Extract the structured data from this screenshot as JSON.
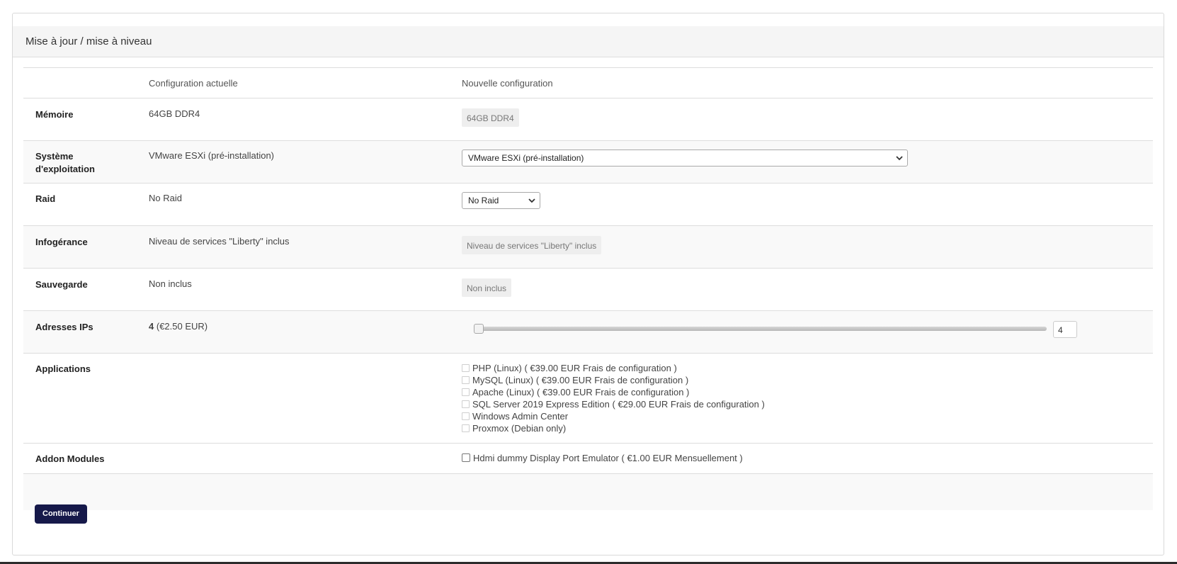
{
  "panel": {
    "title": "Mise à jour / mise à niveau"
  },
  "table": {
    "header": {
      "current": "Configuration actuelle",
      "new": "Nouvelle configuration"
    },
    "rows": {
      "memory": {
        "label": "Mémoire",
        "current": "64GB DDR4",
        "new": "64GB DDR4"
      },
      "os": {
        "label": "Système d'exploitation",
        "current": "VMware ESXi (pré-installation)",
        "new_selected": "VMware ESXi (pré-installation)"
      },
      "raid": {
        "label": "Raid",
        "current": "No Raid",
        "new_selected": "No Raid"
      },
      "managed": {
        "label": "Infogérance",
        "current": "Niveau de services \"Liberty\" inclus",
        "new": "Niveau de services \"Liberty\" inclus"
      },
      "backup": {
        "label": "Sauvegarde",
        "current": "Non inclus",
        "new": "Non inclus"
      },
      "ips": {
        "label": "Adresses IPs",
        "current_qty": "4",
        "current_price": "(€2.50 EUR)",
        "slider_value": "4",
        "slider_fraction": 0.0
      },
      "applications": {
        "label": "Applications",
        "options": [
          "PHP (Linux) ( €39.00 EUR Frais de configuration )",
          "MySQL (Linux) ( €39.00 EUR Frais de configuration )",
          "Apache (Linux) ( €39.00 EUR Frais de configuration )",
          "SQL Server 2019 Express Edition ( €29.00 EUR Frais de configuration )",
          "Windows Admin Center",
          "Proxmox (Debian only)"
        ]
      },
      "addons": {
        "label": "Addon Modules",
        "options": [
          "Hdmi dummy Display Port Emulator ( €1.00 EUR Mensuellement )"
        ]
      }
    }
  },
  "actions": {
    "continue_label": "Continuer"
  },
  "colors": {
    "button_bg": "#16194a",
    "row_alt": "#f9f9f9"
  }
}
